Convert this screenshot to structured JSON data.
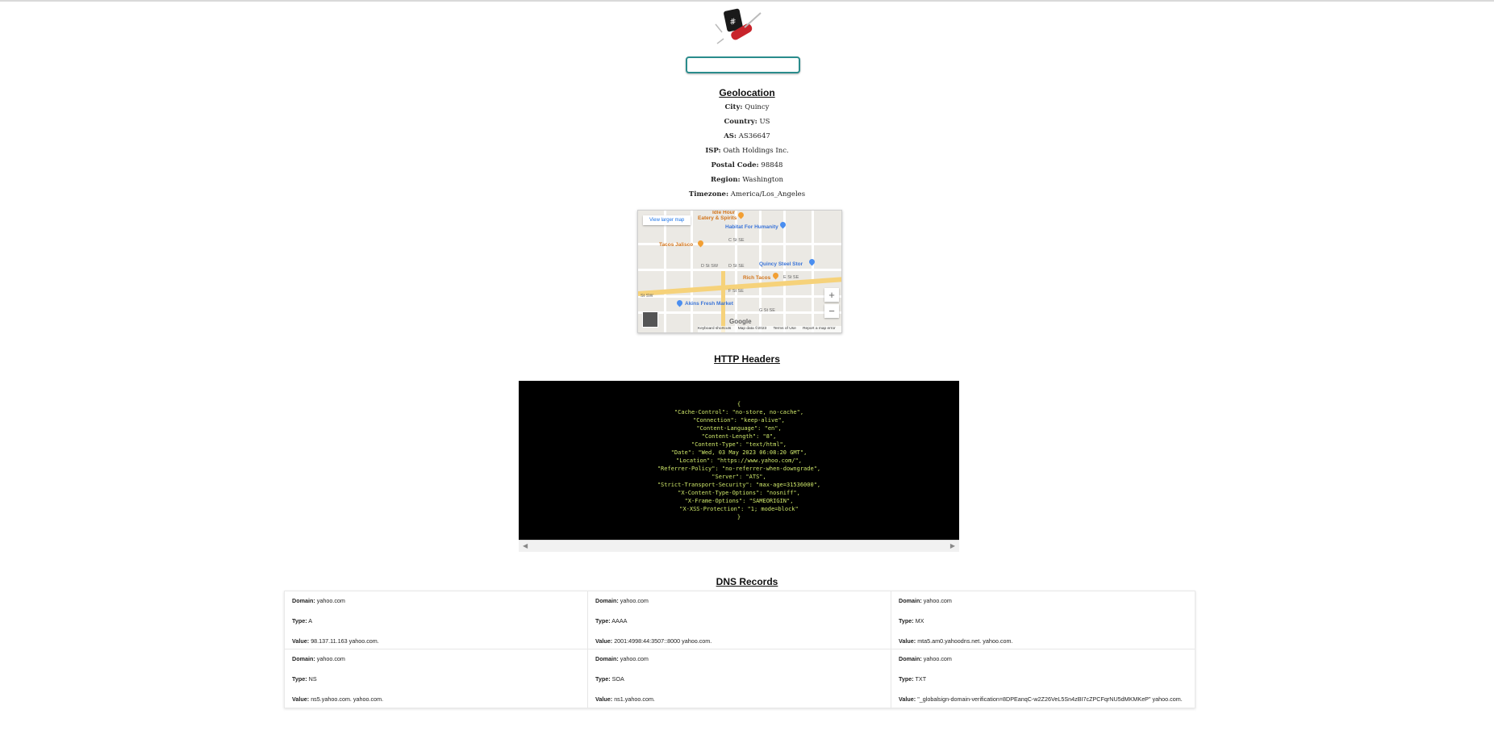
{
  "search": {
    "value": "",
    "placeholder": ""
  },
  "geolocation": {
    "title": "Geolocation",
    "rows": [
      {
        "label": "City:",
        "value": "Quincy"
      },
      {
        "label": "Country:",
        "value": "US"
      },
      {
        "label": "AS:",
        "value": "AS36647"
      },
      {
        "label": "ISP:",
        "value": "Oath Holdings Inc."
      },
      {
        "label": "Postal Code:",
        "value": "98848"
      },
      {
        "label": "Region:",
        "value": "Washington"
      },
      {
        "label": "Timezone:",
        "value": "America/Los_Angeles"
      }
    ]
  },
  "map": {
    "view_larger": "View larger map",
    "zoom_in": "+",
    "zoom_out": "−",
    "google": "Google",
    "footer": {
      "shortcuts": "Keyboard shortcuts",
      "map_data": "Map data ©2023",
      "terms": "Terms of Use",
      "report": "Report a map error"
    },
    "pois": {
      "idle_hour": "Idle Hour",
      "eatery": "Eatery & Spirits",
      "habitat": "Habitat For Humanity",
      "tacos_jalisco": "Tacos Jalisco",
      "quincy_steel": "Quincy Steel Stor",
      "rich_tacos": "Rich Tacos",
      "akins": "Akins Fresh Market"
    },
    "streets": {
      "c_st_se": "C St SE",
      "d_st_sw": "D St SW",
      "d_st_se": "D St SE",
      "e_st_se": "E St SE",
      "f_st_se": "F St SE",
      "g_st_se": "G St SE",
      "st_sw": "St SW"
    }
  },
  "http_headers": {
    "title": "HTTP Headers",
    "lines": [
      "{",
      "\"Cache-Control\": \"no-store, no-cache\",",
      "\"Connection\": \"keep-alive\",",
      "\"Content-Language\": \"en\",",
      "\"Content-Length\": \"8\",",
      "\"Content-Type\": \"text/html\",",
      "\"Date\": \"Wed, 03 May 2023 06:08:20 GMT\",",
      "\"Location\": \"https://www.yahoo.com/\",",
      "\"Referrer-Policy\": \"no-referrer-when-downgrade\",",
      "\"Server\": \"ATS\",",
      "\"Strict-Transport-Security\": \"max-age=31536000\",",
      "\"X-Content-Type-Options\": \"nosniff\",",
      "\"X-Frame-Options\": \"SAMEORIGIN\",",
      "\"X-XSS-Protection\": \"1; mode=block\"",
      "}"
    ]
  },
  "dns": {
    "title": "DNS Records",
    "labels": {
      "domain": "Domain:",
      "type": "Type:",
      "value": "Value:"
    },
    "records": [
      {
        "domain": "yahoo.com",
        "type": "A",
        "value": "98.137.11.163 yahoo.com."
      },
      {
        "domain": "yahoo.com",
        "type": "AAAA",
        "value": "2001:4998:44:3507::8000 yahoo.com."
      },
      {
        "domain": "yahoo.com",
        "type": "MX",
        "value": "mta5.am0.yahoodns.net. yahoo.com."
      },
      {
        "domain": "yahoo.com",
        "type": "NS",
        "value": "ns5.yahoo.com. yahoo.com."
      },
      {
        "domain": "yahoo.com",
        "type": "SOA",
        "value": "ns1.yahoo.com."
      },
      {
        "domain": "yahoo.com",
        "type": "TXT",
        "value": "\"_globalsign-domain-verification=8DPEanqC-w2Z26VeL5Sn4zBI7cZPCFqrNU5dMKMKeP\" yahoo.com."
      }
    ]
  },
  "colors": {
    "accent": "#2a8c8c",
    "terminal_bg": "#000000",
    "terminal_text": "#cfe86a"
  }
}
